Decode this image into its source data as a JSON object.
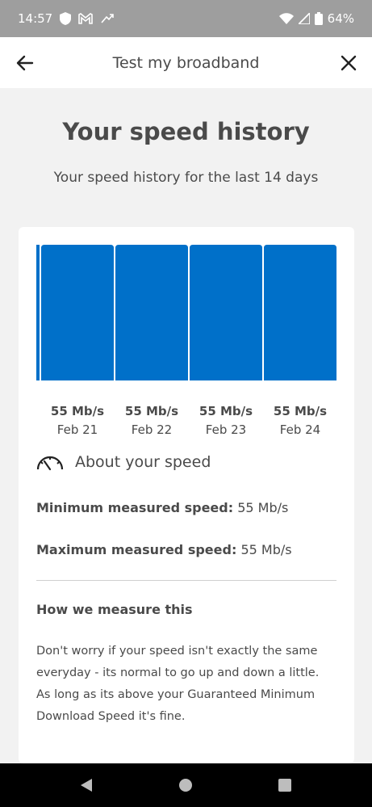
{
  "status_bar": {
    "time": "14:57",
    "battery": "64%",
    "icons": [
      "shield-icon",
      "gmail-icon",
      "missed-call-icon",
      "wifi-icon",
      "signal-icon",
      "battery-icon"
    ]
  },
  "app_bar": {
    "title": "Test my broadband",
    "icons": [
      "back-arrow-icon",
      "close-icon"
    ]
  },
  "page": {
    "heading": "Your speed history",
    "subheading": "Your speed history for the last 14 days"
  },
  "chart_data": {
    "type": "bar",
    "categories": [
      "Feb 21",
      "Feb 22",
      "Feb 23",
      "Feb 24"
    ],
    "values": [
      55,
      55,
      55,
      55
    ],
    "value_labels": [
      "55 Mb/s",
      "55 Mb/s",
      "55 Mb/s",
      "55 Mb/s"
    ],
    "unit": "Mb/s",
    "bar_color": "#0070c9",
    "partial_bar_left": true
  },
  "about": {
    "title": "About your speed",
    "icon": "speedometer-icon",
    "min_label": "Minimum measured speed:",
    "min_value": "55 Mb/s",
    "max_label": "Maximum measured speed:",
    "max_value": "55 Mb/s"
  },
  "how": {
    "title": "How we measure this",
    "lines": [
      "Don't worry if your speed isn't exactly the same",
      "everyday - its normal to go up and down a little.",
      "As long as its above your Guaranteed Minimum",
      "Download Speed it's fine."
    ]
  },
  "nav": {
    "icons": [
      "nav-back-icon",
      "nav-home-icon",
      "nav-recents-icon"
    ]
  }
}
